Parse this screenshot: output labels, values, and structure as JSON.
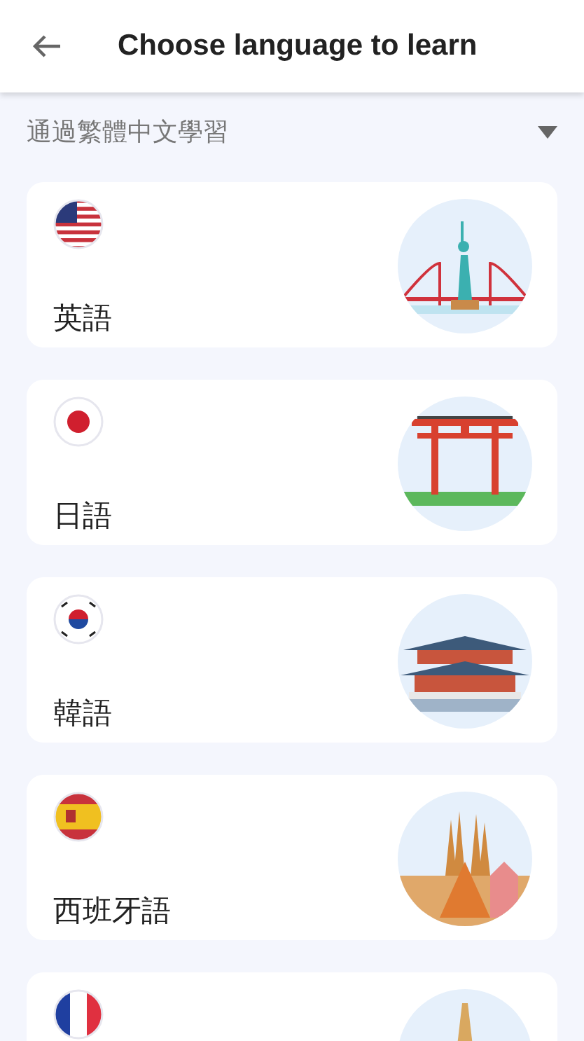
{
  "header": {
    "title": "Choose language to learn"
  },
  "source_language": {
    "value": "通過繁體中文學習"
  },
  "languages": [
    {
      "kind": "us",
      "name": "英語"
    },
    {
      "kind": "japan",
      "name": "日語"
    },
    {
      "kind": "korea",
      "name": "韓語"
    },
    {
      "kind": "spain",
      "name": "西班牙語"
    },
    {
      "kind": "france"
    }
  ]
}
